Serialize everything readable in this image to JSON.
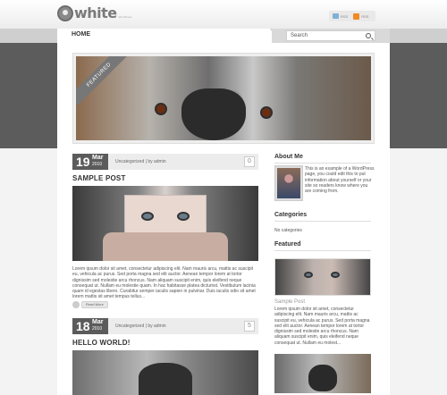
{
  "header": {
    "logo_text": "white",
    "logo_sub": "WordPress",
    "feeds": [
      {
        "label": "RSS",
        "icon": "mail-icon"
      },
      {
        "label": "RSS",
        "icon": "rss-icon"
      }
    ]
  },
  "nav": {
    "home_label": "HOME",
    "search_placeholder": "Search"
  },
  "featured": {
    "ribbon": "FEATURED"
  },
  "posts": [
    {
      "day": "19",
      "month": "Mar",
      "year": "2010",
      "meta": "Uncategorized | by admin",
      "comments": "0",
      "title": "SAMPLE POST",
      "excerpt": "Lorem ipsum dolor sit amet, consectetur adipiscing elit. Nam mauris arcu, mattis ac suscipit eu, vehicula ac purus. Sed porta magna sed elit auctor. Aenean tempor lorem at tortor dignissim sed molestie arcu rhoncus. Nam aliquam suscipit enim, quis eleifend neque consequat ut. Nullam eu molestie quam. In hac habitasse platea dictumst. Vestibulum lacinia quam id egestas libero. Curabitur semper iaculis sapien in pulvinar. Duis iaculis odio sit amet lorem mattis sit amet tempus tellus...",
      "read_more": "Read More"
    },
    {
      "day": "18",
      "month": "Mar",
      "year": "2010",
      "meta": "Uncategorized | by admin",
      "comments": "5",
      "title": "HELLO WORLD!"
    }
  ],
  "sidebar": {
    "about_title": "About Me",
    "about_text": "This is an example of a WordPress page, you could edit this to put information about yourself or your site so readers know where you are coming from.",
    "categories_title": "Categories",
    "no_categories": "No categories",
    "featured_title": "Featured",
    "featured_post_title": "Sample Post",
    "featured_post_excerpt": "Lorem ipsum dolor sit amet, consectetur adipiscing elit. Nam mauris arcu, mattis ac suscipit eu, vehicula ac purus. Sed porta magna sed elit auctor. Aenean tempor lorem at tortor dignissim sed molestie arcu rhoncus. Nam aliquam suscipit enim, quis eleifend neque consequat ut. Nullam eu molest..."
  }
}
